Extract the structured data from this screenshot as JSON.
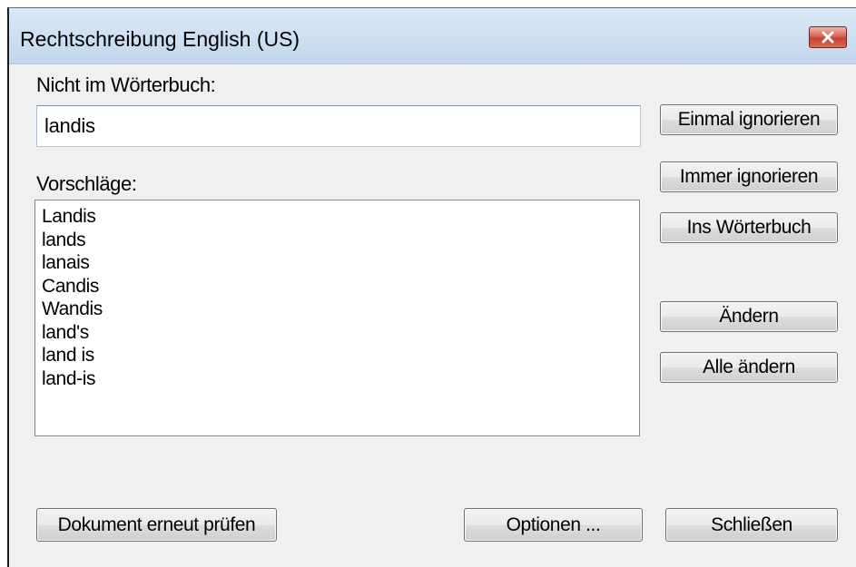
{
  "window": {
    "title": "Rechtschreibung English (US)"
  },
  "not_in_dictionary": {
    "label": "Nicht im Wörterbuch:",
    "value": "landis"
  },
  "suggestions": {
    "label": "Vorschläge:",
    "items": [
      "Landis",
      "lands",
      "lanais",
      "Candis",
      "Wandis",
      "land's",
      "land is",
      "land-is"
    ]
  },
  "buttons": {
    "ignore_once": "Einmal ignorieren",
    "ignore_all": "Immer ignorieren",
    "add_to_dictionary": "Ins Wörterbuch",
    "change": "Ändern",
    "change_all": "Alle ändern",
    "recheck_document": "Dokument erneut prüfen",
    "options": "Optionen ...",
    "close": "Schließen"
  },
  "icons": {
    "close": "close-icon"
  },
  "colors": {
    "close_button": "#c44131",
    "title_bar": "#cfe0f2",
    "dialog_background": "#f0f0f0"
  }
}
